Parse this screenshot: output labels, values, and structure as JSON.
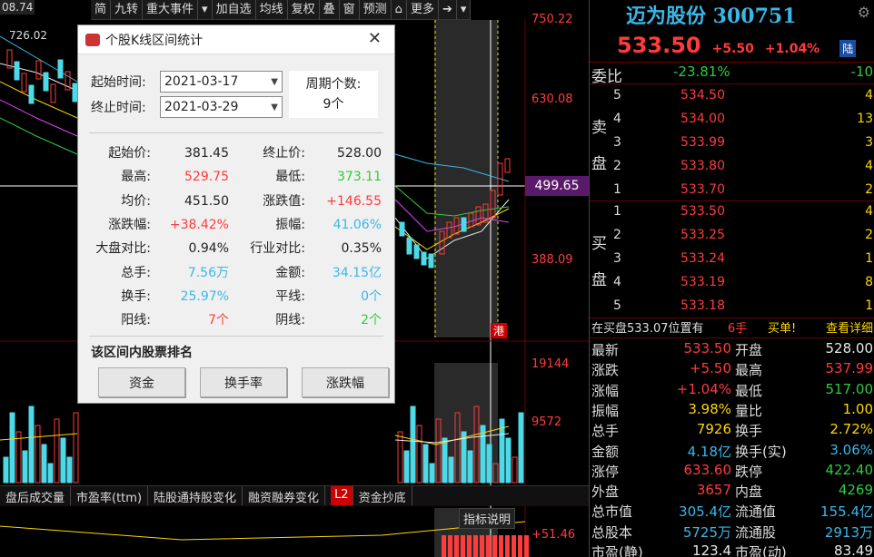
{
  "toolbar": {
    "left_value": "08.74",
    "items": [
      "简",
      "九转",
      "重大事件",
      "▾",
      "加自选",
      "均线",
      "复权",
      "叠",
      "窗",
      "预测",
      "⌂",
      "更多",
      "➔",
      "▾"
    ]
  },
  "chart": {
    "high_mark": "726.02",
    "y_labels": [
      "750.22",
      "630.08",
      "499.65",
      "388.09",
      "19144",
      "9572",
      "+51.46"
    ],
    "current_price_label": "499.65",
    "gang_label": "港"
  },
  "bottom_tabs": [
    "盘后成交量",
    "市盈率(ttm)",
    "陆股通持股变化",
    "融资融券变化",
    "L2",
    "资金抄底"
  ],
  "indicator_desc": "指标说明",
  "dialog": {
    "title": "个股K线区间统计",
    "start_label": "起始时间:",
    "start_value": "2021-03-17",
    "end_label": "终止时间:",
    "end_value": "2021-03-29",
    "cycle_label": "周期个数:",
    "cycle_value": "9个",
    "stats": [
      {
        "k": "起始价:",
        "v": "381.45",
        "c": "white",
        "k2": "终止价:",
        "v2": "528.00",
        "c2": "white"
      },
      {
        "k": "最高:",
        "v": "529.75",
        "c": "red",
        "k2": "最低:",
        "v2": "373.11",
        "c2": "green"
      },
      {
        "k": "均价:",
        "v": "451.50",
        "c": "white",
        "k2": "涨跌值:",
        "v2": "+146.55",
        "c2": "red"
      },
      {
        "k": "涨跌幅:",
        "v": "+38.42%",
        "c": "red",
        "k2": "振幅:",
        "v2": "41.06%",
        "c2": "cyan"
      },
      {
        "k": "大盘对比:",
        "v": "0.94%",
        "c": "white",
        "k2": "行业对比:",
        "v2": "0.35%",
        "c2": "white"
      },
      {
        "k": "总手:",
        "v": "7.56万",
        "c": "cyan",
        "k2": "金额:",
        "v2": "34.15亿",
        "c2": "cyan"
      },
      {
        "k": "换手:",
        "v": "25.97%",
        "c": "cyan",
        "k2": "平线:",
        "v2": "0个",
        "c2": "cyan"
      },
      {
        "k": "阳线:",
        "v": "7个",
        "c": "red",
        "k2": "阴线:",
        "v2": "2个",
        "c2": "green"
      }
    ],
    "rank_label": "该区间内股票排名",
    "buttons": [
      "资金",
      "换手率",
      "涨跌幅"
    ]
  },
  "quote": {
    "name": "迈为股份 300751",
    "price": "533.50",
    "change": "+5.50",
    "pct": "+1.04%",
    "market": "陆",
    "weibi_label": "委比",
    "weibi_value": "-23.81%",
    "weibi_diff": "-10",
    "sell_label": [
      "卖",
      "盘"
    ],
    "buy_label": [
      "买",
      "盘"
    ],
    "sells": [
      {
        "n": "5",
        "p": "534.50",
        "v": "4"
      },
      {
        "n": "4",
        "p": "534.00",
        "v": "13"
      },
      {
        "n": "3",
        "p": "533.99",
        "v": "3"
      },
      {
        "n": "2",
        "p": "533.80",
        "v": "4"
      },
      {
        "n": "1",
        "p": "533.70",
        "v": "2"
      }
    ],
    "buys": [
      {
        "n": "1",
        "p": "533.50",
        "v": "4"
      },
      {
        "n": "2",
        "p": "533.25",
        "v": "2"
      },
      {
        "n": "3",
        "p": "533.24",
        "v": "1"
      },
      {
        "n": "4",
        "p": "533.19",
        "v": "8"
      },
      {
        "n": "5",
        "p": "533.18",
        "v": "1"
      }
    ],
    "notice_pre": "在买盘533.07位置有",
    "notice_qty": "6手",
    "notice_act": "买单!",
    "notice_link": "查看详细",
    "info": [
      {
        "k": "最新",
        "v": "533.50",
        "c": "red",
        "k2": "开盘",
        "v2": "528.00",
        "c2": "white"
      },
      {
        "k": "涨跌",
        "v": "+5.50",
        "c": "red",
        "k2": "最高",
        "v2": "537.99",
        "c2": "red"
      },
      {
        "k": "涨幅",
        "v": "+1.04%",
        "c": "red",
        "k2": "最低",
        "v2": "517.00",
        "c2": "green"
      },
      {
        "k": "振幅",
        "v": "3.98%",
        "c": "yellow",
        "k2": "量比",
        "v2": "1.00",
        "c2": "yellow"
      },
      {
        "k": "总手",
        "v": "7926",
        "c": "yellow",
        "k2": "换手",
        "v2": "2.72%",
        "c2": "yellow"
      },
      {
        "k": "金额",
        "v": "4.18亿",
        "c": "cyan",
        "k2": "换手(实)",
        "v2": "3.06%",
        "c2": "cyan"
      },
      {
        "k": "涨停",
        "v": "633.60",
        "c": "red",
        "k2": "跌停",
        "v2": "422.40",
        "c2": "green"
      },
      {
        "k": "外盘",
        "v": "3657",
        "c": "red",
        "k2": "内盘",
        "v2": "4269",
        "c2": "green"
      },
      {
        "k": "总市值",
        "v": "305.4亿",
        "c": "cyan",
        "k2": "流通值",
        "v2": "155.4亿",
        "c2": "cyan"
      },
      {
        "k": "总股本",
        "v": "5725万",
        "c": "cyan",
        "k2": "流通股",
        "v2": "2913万",
        "c2": "cyan"
      },
      {
        "k": "市盈(静)",
        "v": "123.4",
        "c": "white",
        "k2": "市盈(动)",
        "v2": "83.49",
        "c2": "white"
      }
    ]
  },
  "colors": {
    "up": "#ff3b3b",
    "down": "#2ecc40",
    "cyan": "#3ab7e8",
    "vol_down": "#4dd9e8"
  }
}
